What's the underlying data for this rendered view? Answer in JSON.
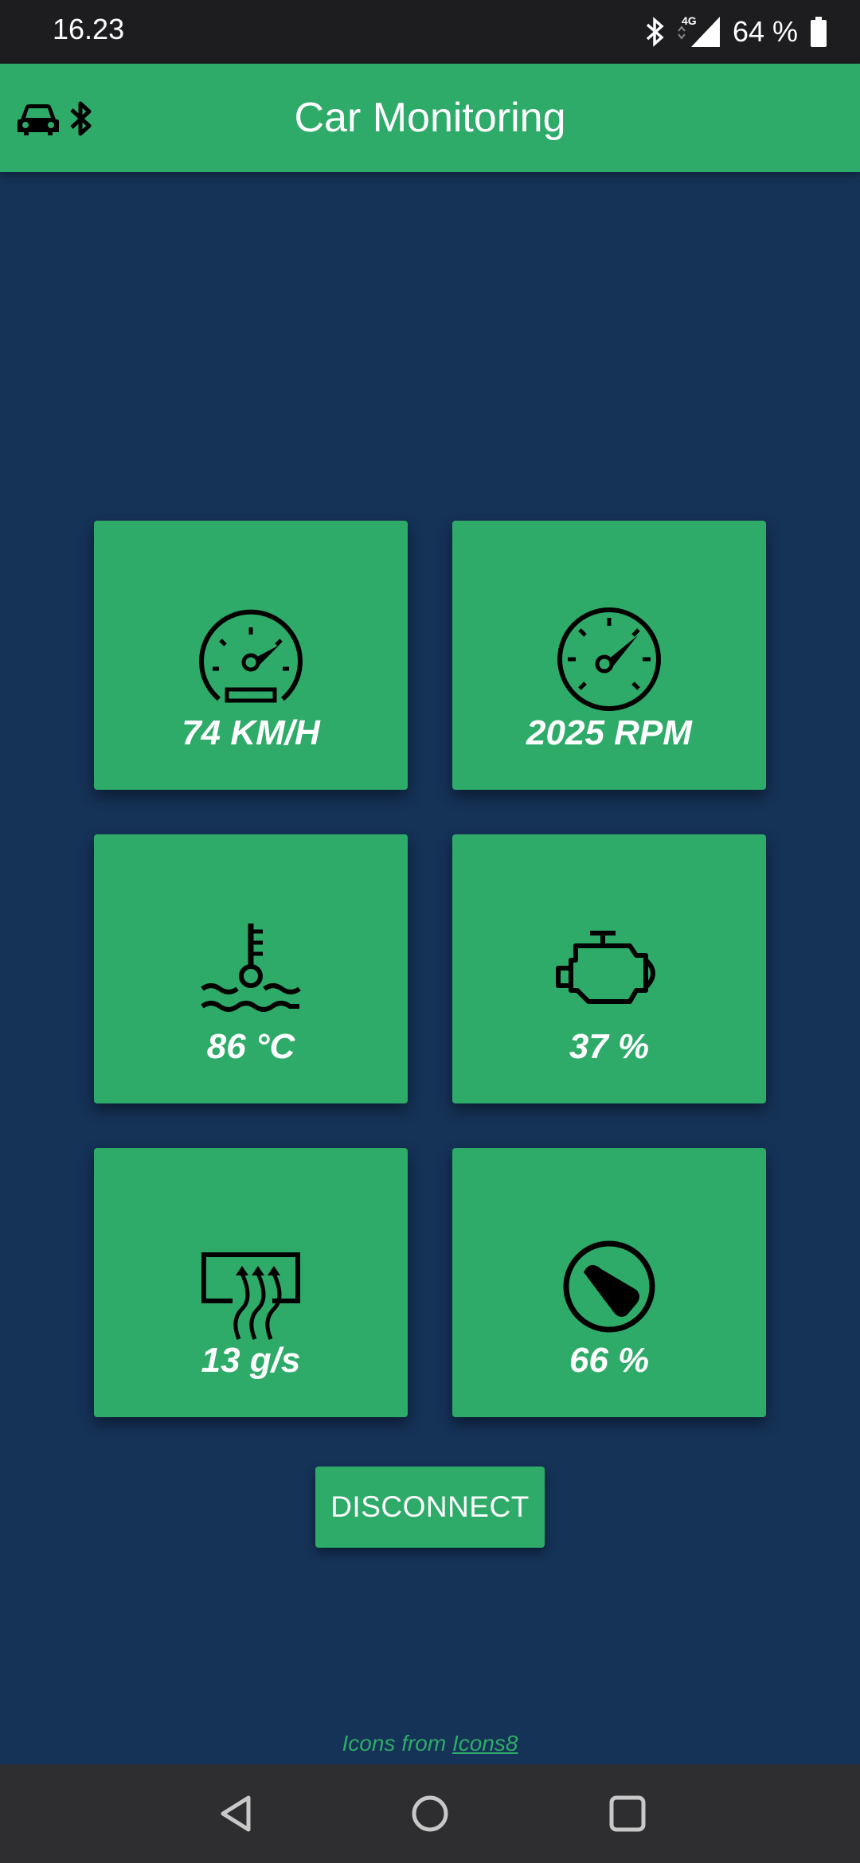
{
  "status_bar": {
    "time": "16.23",
    "battery_text": "64 %",
    "network_label": "4G",
    "icons": [
      "bluetooth-icon",
      "signal-icon",
      "battery-icon"
    ]
  },
  "app_bar": {
    "title": "Car Monitoring",
    "icons": [
      "car-icon",
      "bluetooth-icon"
    ]
  },
  "tiles": [
    {
      "icon": "speedometer-icon",
      "value": "74 KM/H"
    },
    {
      "icon": "tachometer-icon",
      "value": "2025 RPM"
    },
    {
      "icon": "coolant-temperature-icon",
      "value": "86 °C"
    },
    {
      "icon": "engine-icon",
      "value": "37 %"
    },
    {
      "icon": "airflow-icon",
      "value": "13 g/s"
    },
    {
      "icon": "throttle-icon",
      "value": "66 %"
    }
  ],
  "disconnect_label": "DISCONNECT",
  "credit": {
    "prefix": "Icons from ",
    "link": "Icons8"
  },
  "navigation": [
    "back-icon",
    "home-icon",
    "recents-icon"
  ],
  "colors": {
    "accent": "#2eab69",
    "background": "#153257"
  }
}
